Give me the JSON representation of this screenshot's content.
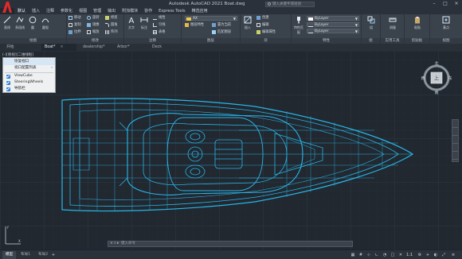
{
  "window": {
    "title": "Autodesk AutoCAD 2021   Boat.dwg",
    "search_placeholder": "键入关键字或短语"
  },
  "menu": {
    "items": [
      {
        "label": "默认",
        "active": true
      },
      {
        "label": "插入"
      },
      {
        "label": "注释"
      },
      {
        "label": "参数化"
      },
      {
        "label": "视图"
      },
      {
        "label": "管理"
      },
      {
        "label": "输出"
      },
      {
        "label": "附加模块"
      },
      {
        "label": "协作"
      },
      {
        "label": "Express Tools"
      },
      {
        "label": "精选应用"
      }
    ]
  },
  "ribbon": {
    "draw": {
      "title": "绘图",
      "tools": [
        "直线",
        "多段线",
        "圆",
        "圆弧"
      ]
    },
    "modify": {
      "title": "修改",
      "tools": [
        "移动",
        "旋转",
        "修剪",
        "复制",
        "镜像",
        "圆角",
        "拉伸",
        "缩放",
        "阵列"
      ]
    },
    "annotation": {
      "title": "注释",
      "tools": [
        "文字",
        "标注",
        "线性",
        "引线",
        "表格"
      ]
    },
    "layers": {
      "title": "图层",
      "current_layer": "AX",
      "tools": [
        "图层特性",
        "置为当前",
        "匹配图层"
      ]
    },
    "block": {
      "title": "块",
      "tools": [
        "插入",
        "创建",
        "编辑",
        "编辑属性"
      ]
    },
    "properties": {
      "title": "特性",
      "tools": [
        "特性匹配"
      ],
      "color": "ByLayer",
      "linetype": "ByLayer",
      "lineweight": "ByLayer"
    },
    "groups": {
      "title": "组",
      "tools": [
        "组"
      ]
    },
    "utilities": {
      "title": "实用工具",
      "tools": [
        "测量"
      ]
    },
    "clipboard": {
      "title": "剪贴板",
      "tools": [
        "粘贴"
      ]
    },
    "view": {
      "title": "视图",
      "tools": [
        "基点"
      ]
    }
  },
  "file_tabs": [
    {
      "label": "开始"
    },
    {
      "label": "Boat*",
      "active": true
    },
    {
      "label": "dealership*"
    },
    {
      "label": "Arbor*"
    },
    {
      "label": "Deck"
    }
  ],
  "viewport": {
    "label": "[-][俯视][二维线框]",
    "context_menu": [
      {
        "label": "恢复视口",
        "checked": false,
        "highlight": true
      },
      {
        "label": "视口配置列表",
        "checked": false,
        "submenu": true
      },
      {
        "label": "ViewCube",
        "checked": true
      },
      {
        "label": "SteeringWheels",
        "checked": true
      },
      {
        "label": "导航栏",
        "checked": true
      }
    ],
    "viewcube": {
      "north": "北",
      "south": "南",
      "west": "西",
      "east": "东",
      "top": "上"
    }
  },
  "command": {
    "placeholder": "键入命令"
  },
  "status": {
    "tabs": [
      {
        "label": "模型",
        "active": true
      },
      {
        "label": "布局1"
      },
      {
        "label": "布局2"
      }
    ],
    "scale": "1:1"
  },
  "colors": {
    "accent": "#4aa3df",
    "drawing": "#29b5e8",
    "canvas_bg": "#212830",
    "ribbon_bg": "#3a424c"
  }
}
